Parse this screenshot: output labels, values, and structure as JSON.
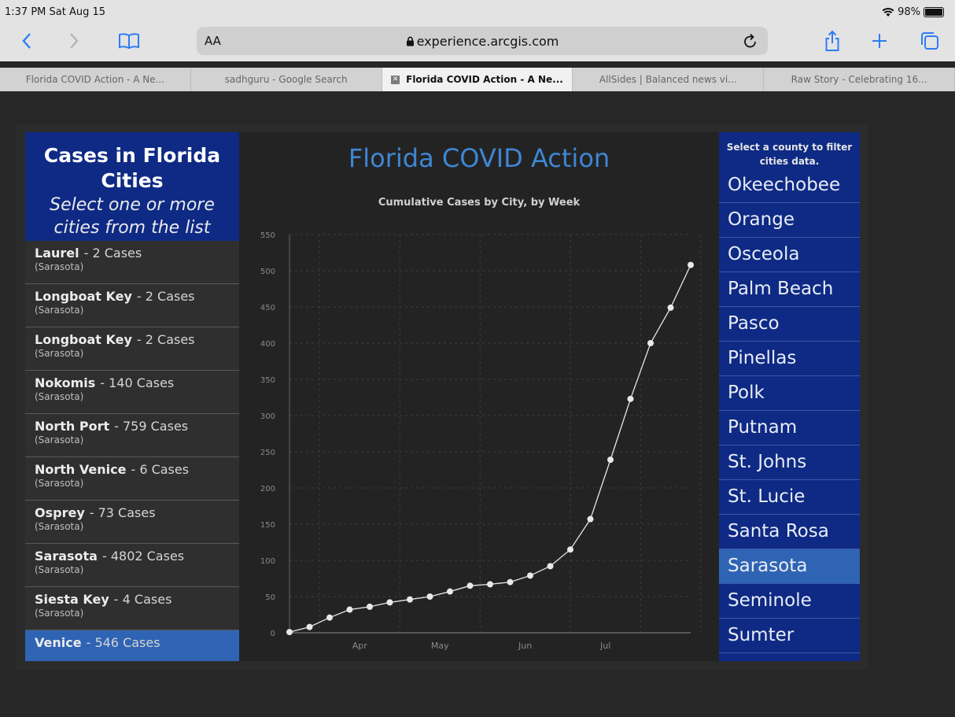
{
  "status": {
    "time": "1:37 PM  Sat Aug 15",
    "battery": "98%"
  },
  "browser": {
    "text_size_label": "AA",
    "url": "experience.arcgis.com",
    "icons": [
      "back-icon",
      "forward-icon",
      "bookmarks-icon",
      "reload-icon",
      "share-icon",
      "new-tab-icon",
      "tabs-overview-icon"
    ]
  },
  "tabs": [
    {
      "label": "Florida COVID Action - A Ne...",
      "active": false
    },
    {
      "label": "sadhguru - Google Search",
      "active": false
    },
    {
      "label": "Florida COVID Action - A Ne...",
      "active": true
    },
    {
      "label": "AllSides | Balanced news vi...",
      "active": false
    },
    {
      "label": "Raw Story - Celebrating 16...",
      "active": false
    }
  ],
  "left_panel": {
    "title": "Cases in Florida Cities",
    "subtitle": "Select one or more cities from the list",
    "cities": [
      {
        "name": "Laurel",
        "cases": "- 2 Cases",
        "county": "(Sarasota)"
      },
      {
        "name": "Longboat Key",
        "cases": "- 2 Cases",
        "county": "(Sarasota)"
      },
      {
        "name": "Longboat Key",
        "cases": "- 2 Cases",
        "county": "(Sarasota)"
      },
      {
        "name": "Nokomis",
        "cases": "- 140 Cases",
        "county": "(Sarasota)"
      },
      {
        "name": "North Port",
        "cases": "- 759 Cases",
        "county": "(Sarasota)"
      },
      {
        "name": "North Venice",
        "cases": "- 6 Cases",
        "county": "(Sarasota)"
      },
      {
        "name": "Osprey",
        "cases": "- 73 Cases",
        "county": "(Sarasota)"
      },
      {
        "name": "Sarasota",
        "cases": "- 4802 Cases",
        "county": "(Sarasota)"
      },
      {
        "name": "Siesta Key",
        "cases": "- 4 Cases",
        "county": "(Sarasota)"
      },
      {
        "name": "Venice",
        "cases": "- 546 Cases",
        "county": "",
        "selected": true
      }
    ]
  },
  "main": {
    "title": "Florida COVID Action"
  },
  "right_panel": {
    "hint": "Select a county to filter cities data.",
    "counties": [
      {
        "name": "Okeechobee"
      },
      {
        "name": "Orange"
      },
      {
        "name": "Osceola"
      },
      {
        "name": "Palm Beach"
      },
      {
        "name": "Pasco"
      },
      {
        "name": "Pinellas"
      },
      {
        "name": "Polk"
      },
      {
        "name": "Putnam"
      },
      {
        "name": "St. Johns"
      },
      {
        "name": "St. Lucie"
      },
      {
        "name": "Santa Rosa"
      },
      {
        "name": "Sarasota",
        "selected": true
      },
      {
        "name": "Seminole"
      },
      {
        "name": "Sumter"
      }
    ]
  },
  "colors": {
    "accent": "#3e86d4",
    "panel_blue": "#0e2a84",
    "selected": "#2f64b4"
  },
  "chart_data": {
    "type": "line",
    "title": "Cumulative Cases by City, by Week",
    "xlabel": "",
    "ylabel": "",
    "ylim": [
      0,
      550
    ],
    "yticks": [
      0,
      50,
      100,
      150,
      200,
      250,
      300,
      350,
      400,
      450,
      500,
      550
    ],
    "xticks": [
      "Apr",
      "May",
      "Jun",
      "Jul"
    ],
    "grid": true,
    "series": [
      {
        "values": [
          1,
          8,
          21,
          32,
          36,
          42,
          46,
          50,
          57,
          65,
          67,
          70,
          79,
          92,
          115,
          157,
          239,
          323,
          400,
          449,
          508
        ]
      }
    ]
  }
}
